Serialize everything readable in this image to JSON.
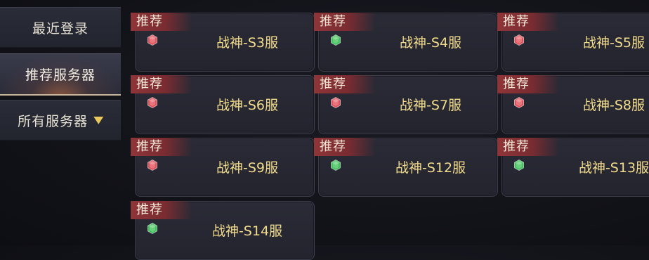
{
  "sidebar": {
    "tabs": [
      {
        "label": "最近登录"
      },
      {
        "label": "推荐服务器"
      },
      {
        "label": "所有服务器"
      }
    ],
    "dropdown_icon": "chevron-down-icon"
  },
  "tag_label": "推荐",
  "colors": {
    "busy": "#e0505a",
    "smooth": "#3fc25a",
    "name": "#f3dc8c"
  },
  "servers": [
    {
      "name": "战神-S3服",
      "status": "busy"
    },
    {
      "name": "战神-S4服",
      "status": "smooth"
    },
    {
      "name": "战神-S5服",
      "status": "busy"
    },
    {
      "name": "战神-S6服",
      "status": "busy"
    },
    {
      "name": "战神-S7服",
      "status": "busy"
    },
    {
      "name": "战神-S8服",
      "status": "busy"
    },
    {
      "name": "战神-S9服",
      "status": "busy"
    },
    {
      "name": "战神-S12服",
      "status": "smooth"
    },
    {
      "name": "战神-S13服",
      "status": "smooth"
    },
    {
      "name": "战神-S14服",
      "status": "smooth"
    }
  ]
}
